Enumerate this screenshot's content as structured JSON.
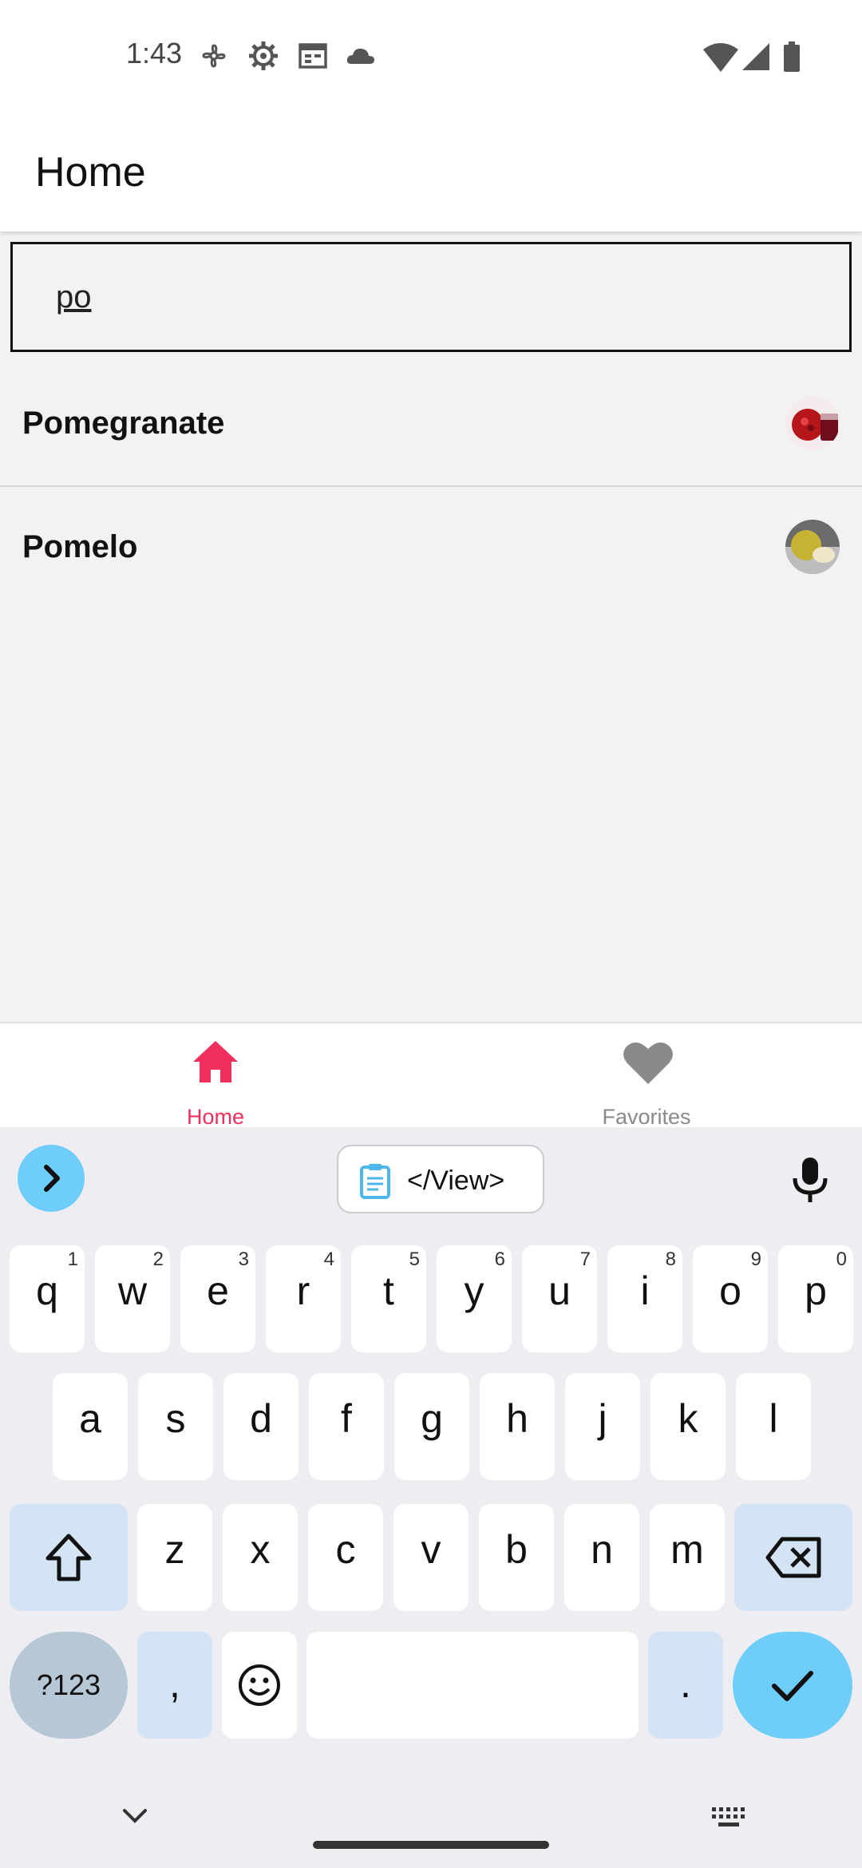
{
  "status_bar": {
    "time": "1:43",
    "left_icons": [
      "fan-icon",
      "gear-icon",
      "calendar-icon",
      "cloud-icon"
    ],
    "right_icons": [
      "wifi-icon",
      "signal-icon",
      "battery-icon"
    ]
  },
  "app_bar": {
    "title": "Home"
  },
  "search": {
    "value": "po"
  },
  "results": [
    {
      "label": "Pomegranate",
      "thumb": "pomegranate-image"
    },
    {
      "label": "Pomelo",
      "thumb": "pomelo-image"
    }
  ],
  "bottom_nav": {
    "items": [
      {
        "label": "Home",
        "icon": "home-icon",
        "active": true
      },
      {
        "label": "Favorites",
        "icon": "heart-icon",
        "active": false
      }
    ],
    "active_color": "#f0305c",
    "inactive_color": "#8a8a8a"
  },
  "keyboard": {
    "clipboard_chip": "</View>",
    "row1": [
      {
        "ch": "q",
        "hint": "1"
      },
      {
        "ch": "w",
        "hint": "2"
      },
      {
        "ch": "e",
        "hint": "3"
      },
      {
        "ch": "r",
        "hint": "4"
      },
      {
        "ch": "t",
        "hint": "5"
      },
      {
        "ch": "y",
        "hint": "6"
      },
      {
        "ch": "u",
        "hint": "7"
      },
      {
        "ch": "i",
        "hint": "8"
      },
      {
        "ch": "o",
        "hint": "9"
      },
      {
        "ch": "p",
        "hint": "0"
      }
    ],
    "row2": [
      "a",
      "s",
      "d",
      "f",
      "g",
      "h",
      "j",
      "k",
      "l"
    ],
    "row3": [
      "z",
      "x",
      "c",
      "v",
      "b",
      "n",
      "m"
    ],
    "symbols_label": "?123",
    "comma": ",",
    "period": ".",
    "accent_color": "#6fcdf9"
  }
}
